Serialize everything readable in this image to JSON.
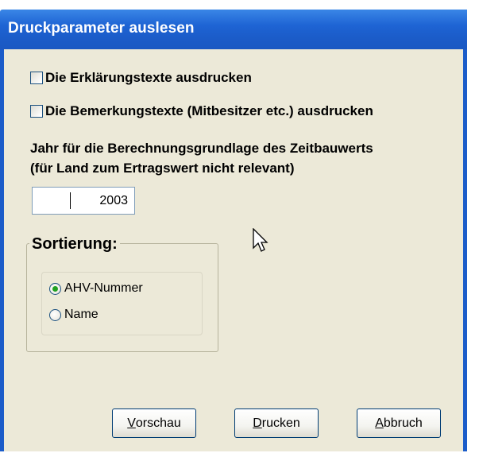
{
  "window": {
    "title": "Druckparameter auslesen"
  },
  "options": {
    "explanations": {
      "label": "Die Erklärungstexte ausdrucken",
      "checked": false
    },
    "remarks": {
      "label": "Die Bemerkungstexte (Mitbesitzer etc.) ausdrucken",
      "checked": false
    }
  },
  "year_section": {
    "line1": "Jahr für die Berechnungsgrundlage des Zeitbauwerts",
    "line2": "(für Land zum Ertragswert nicht relevant)",
    "value": "2003"
  },
  "sort": {
    "title": "Sortierung:",
    "options": [
      {
        "label": "AHV-Nummer",
        "selected": true
      },
      {
        "label": "Name",
        "selected": false
      }
    ]
  },
  "buttons": {
    "preview": {
      "accel": "V",
      "rest": "orschau"
    },
    "print": {
      "accel": "D",
      "rest": "rucken"
    },
    "cancel": {
      "accel": "A",
      "rest": "bbruch"
    }
  },
  "icons": {
    "cursor": "arrow-cursor-icon"
  },
  "colors": {
    "titlebar": "#1b5cc9",
    "dialog_bg": "#ece9d8",
    "radio_selected": "#21a121"
  }
}
